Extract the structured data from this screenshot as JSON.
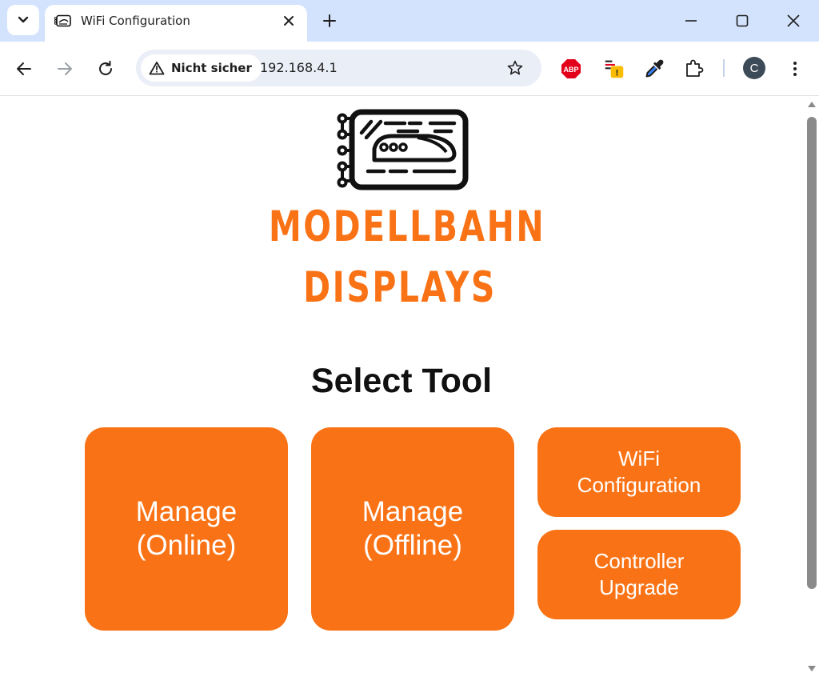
{
  "browser": {
    "tab": {
      "title": "WiFi Configuration",
      "favicon": "train-display-icon"
    },
    "security_chip": "Nicht sicher",
    "url": "192.168.4.1",
    "profile_initial": "C",
    "extensions": [
      "adblock-plus-icon",
      "extension-warning-icon",
      "eyedropper-icon",
      "puzzle-piece-icon"
    ]
  },
  "page": {
    "brand_line1": "MODELLBAHN",
    "brand_line2": "DISPLAYS",
    "heading": "Select Tool",
    "tiles": {
      "manage_online": "Manage\n(Online)",
      "manage_offline": "Manage\n(Offline)",
      "wifi_config": "WiFi\nConfiguration",
      "controller_upgrade": "Controller\nUpgrade"
    },
    "accent_color": "#f97316"
  }
}
